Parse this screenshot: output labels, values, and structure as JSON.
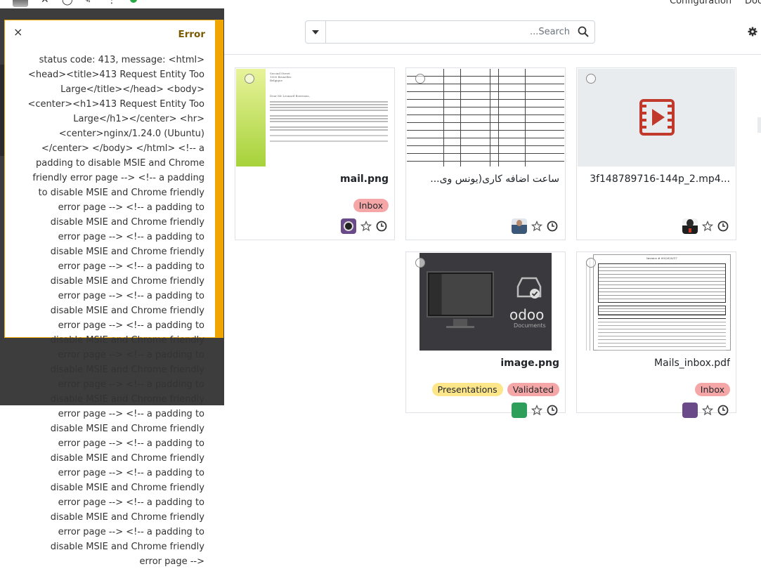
{
  "topbar": {
    "menu_configuration": "Configuration",
    "menu_documents": "Doc"
  },
  "search": {
    "placeholder": "...Search"
  },
  "notification": {
    "title": "Error",
    "close": "×",
    "message": "status code: 413, message: <html> <head><title>413 Request Entity Too Large</title></head> <body> <center><h1>413 Request Entity Too Large</h1></center> <hr> <center>nginx/1.24.0 (Ubuntu) </center> </body> </html> <!-- a padding to disable MSIE and Chrome friendly error page --> <!-- a padding to disable MSIE and Chrome friendly error page --> <!-- a padding to disable MSIE and Chrome friendly error page --> <!-- a padding to disable MSIE and Chrome friendly error page --> <!-- a padding to disable MSIE and Chrome friendly error page --> <!-- a padding to disable MSIE and Chrome friendly error page --> <!-- a padding to disable MSIE and Chrome friendly error page --> <!-- a padding to disable MSIE and Chrome friendly error page --> <!-- a padding to disable MSIE and Chrome friendly error page --> <!-- a padding to disable MSIE and Chrome friendly error page --> <!-- a padding to disable MSIE and Chrome friendly error page --> <!-- a padding to disable MSIE and Chrome friendly error page --> <!-- a padding to disable MSIE and Chrome friendly error page --> <!-- a padding to disable MSIE and Chrome friendly error page -->"
  },
  "cards": [
    {
      "name": "mail.png",
      "tags": [
        "Inbox"
      ],
      "owner_icon": "owner-avatar"
    },
    {
      "name": "ساعت اضافه کاری(یونس وی...",
      "tags": [],
      "owner_icon": "owner-avatar"
    },
    {
      "name": "3f148789716-144p_2.mp4...",
      "tags": [],
      "owner_icon": "owner-avatar"
    },
    {
      "name": "image.png",
      "tags": [
        "Presentations",
        "Validated"
      ],
      "owner_icon": "owner-avatar"
    },
    {
      "name": "Mails_inbox.pdf",
      "tags": [
        "Inbox"
      ],
      "owner_icon": "owner-avatar"
    }
  ],
  "thumb_text": {
    "odoo_logo": "odoo",
    "odoo_sub": "Documents",
    "letter_header": "Second Street\n1000 Bruxelles\nBelgique",
    "letter_greeting": "Dear Mr Leonard Boereans,",
    "invoice_title": "Invoice # 09/2020/17"
  },
  "colors": {
    "warning": "#f0a500",
    "tag_red": "#f5a6a6",
    "tag_yellow": "#fde68a",
    "video_red": "#c0392b"
  }
}
